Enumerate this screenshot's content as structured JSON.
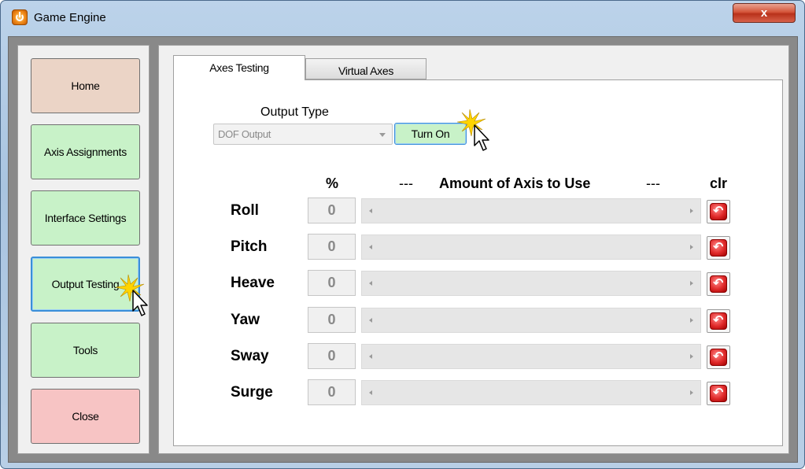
{
  "window": {
    "title": "Game Engine",
    "close_glyph": "x"
  },
  "nav": {
    "home": "Home",
    "axis_assignments": "Axis Assignments",
    "interface_settings": "Interface Settings",
    "output_testing": "Output Testing",
    "tools": "Tools",
    "close": "Close"
  },
  "tabs": {
    "axes_testing": "Axes Testing",
    "virtual_axes": "Virtual Axes"
  },
  "output": {
    "label": "Output Type",
    "selected": "DOF Output",
    "turn_on": "Turn On"
  },
  "headers": {
    "pct": "%",
    "dash_left": "---",
    "amount": "Amount of Axis to Use",
    "dash_right": "---",
    "clr": "clr"
  },
  "axes": [
    {
      "label": "Roll",
      "value": "0"
    },
    {
      "label": "Pitch",
      "value": "0"
    },
    {
      "label": "Heave",
      "value": "0"
    },
    {
      "label": "Yaw",
      "value": "0"
    },
    {
      "label": "Sway",
      "value": "0"
    },
    {
      "label": "Surge",
      "value": "0"
    }
  ],
  "colors": {
    "nav_green": "#c8f2c8",
    "nav_home": "#ebd4c6",
    "nav_close": "#f7c4c4",
    "focus_blue": "#3a8fd8",
    "clr_red": "#e02a2a"
  }
}
